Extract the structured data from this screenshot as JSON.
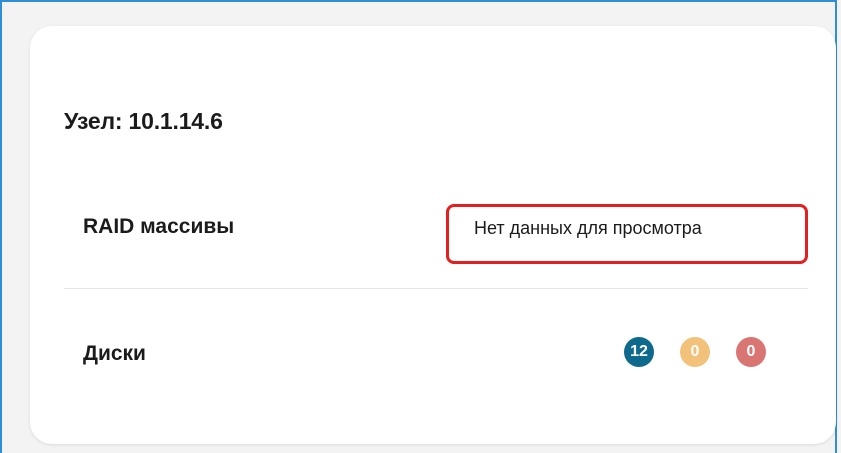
{
  "node": {
    "title": "Узел: 10.1.14.6"
  },
  "raid": {
    "label": "RAID массивы",
    "status_text": "Нет данных для просмотра"
  },
  "disks": {
    "label": "Диски",
    "counts": {
      "ok": "12",
      "warning": "0",
      "error": "0"
    }
  },
  "colors": {
    "ok": "#0e6a8c",
    "warning": "#f2c17a",
    "error": "#d97573",
    "highlight_border": "#e41f1f"
  }
}
